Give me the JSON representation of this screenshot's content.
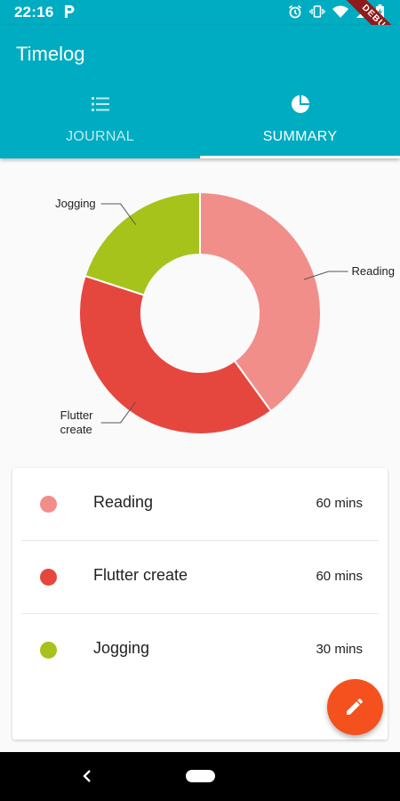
{
  "status_bar": {
    "time": "22:16",
    "debug_label": "DEBUG",
    "icons": [
      "parking-icon",
      "alarm-icon",
      "vibrate-icon",
      "wifi-icon",
      "signal-icon",
      "battery-icon"
    ]
  },
  "app_bar": {
    "title": "Timelog",
    "background": "#00acc1"
  },
  "tabs": [
    {
      "label": "JOURNAL",
      "icon": "list-icon",
      "active": false
    },
    {
      "label": "SUMMARY",
      "icon": "pie-chart-icon",
      "active": true
    }
  ],
  "chart_data": {
    "type": "pie",
    "donut": true,
    "categories": [
      "Reading",
      "Flutter create",
      "Jogging"
    ],
    "values": [
      60,
      60,
      30
    ],
    "colors": [
      "#f28e8a",
      "#e5473f",
      "#a6c31b"
    ],
    "labels": [
      "Reading",
      "Flutter create",
      "Jogging"
    ]
  },
  "summary": {
    "items": [
      {
        "name": "Reading",
        "value": "60 mins",
        "color": "#f28e8a"
      },
      {
        "name": "Flutter create",
        "value": "60 mins",
        "color": "#e5473f"
      },
      {
        "name": "Jogging",
        "value": "30 mins",
        "color": "#a6c31b"
      }
    ]
  },
  "fab": {
    "icon": "pencil-icon",
    "color": "#f4511e"
  },
  "nav": {
    "back_icon": "back-chevron-icon",
    "home_icon": "home-pill-icon"
  }
}
